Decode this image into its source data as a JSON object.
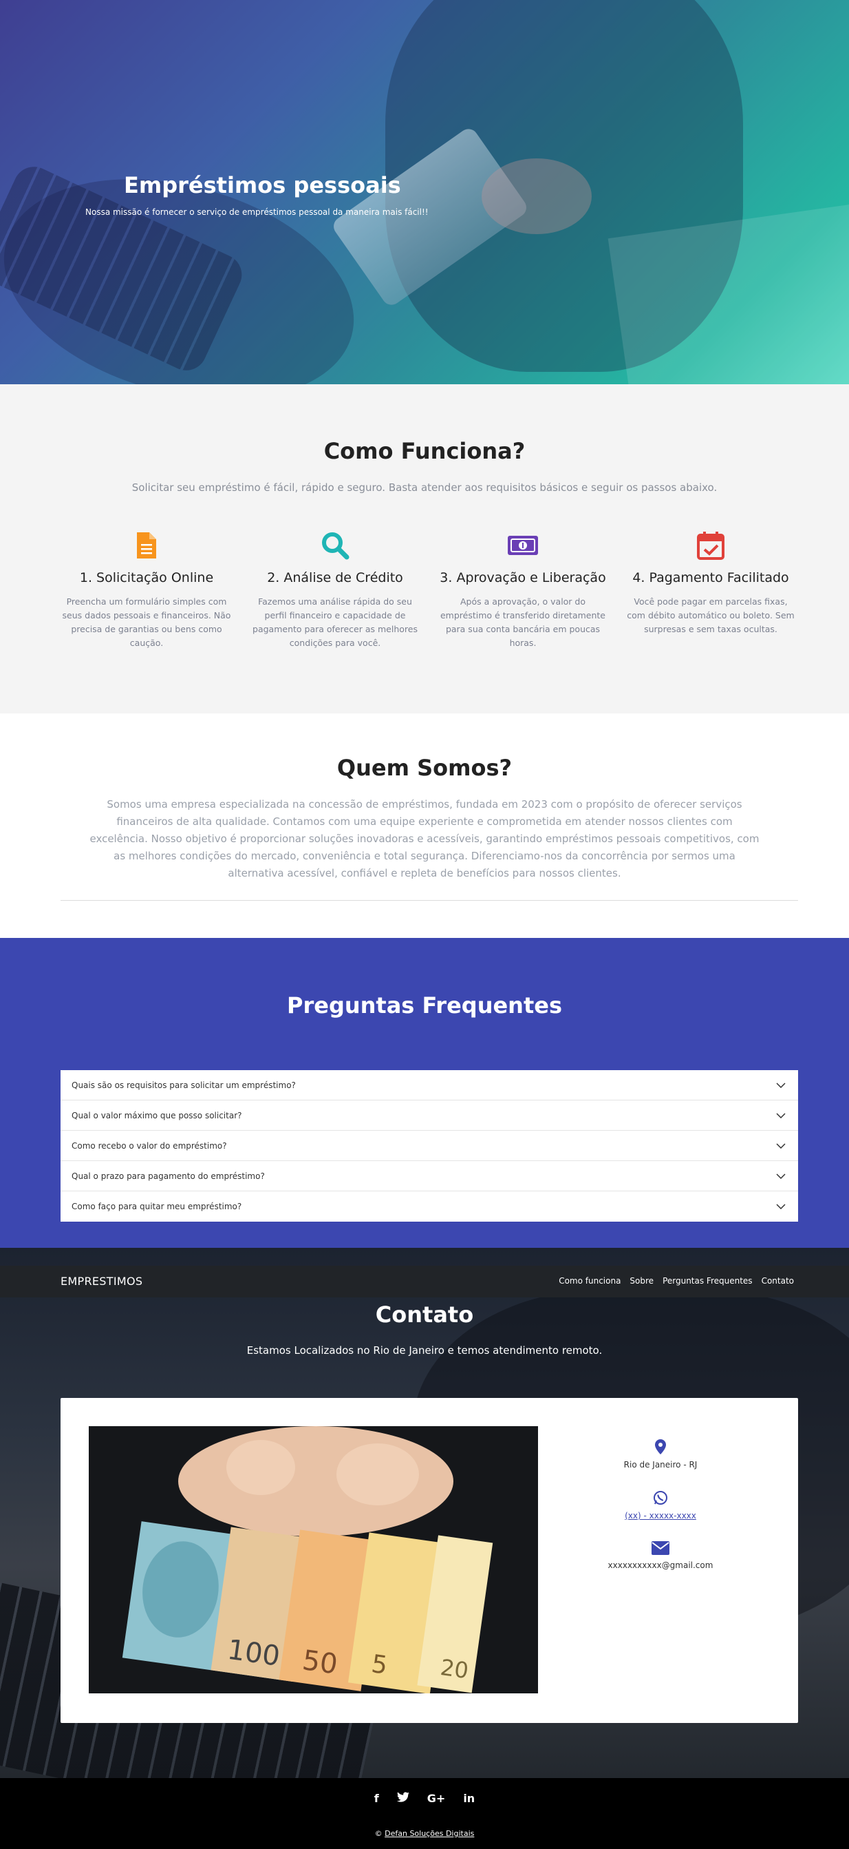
{
  "hero": {
    "title": "Empréstimos pessoais",
    "subtitle": "Nossa missão é fornecer o serviço de empréstimos pessoal da maneira mais fácil!!"
  },
  "como_funciona": {
    "title": "Como Funciona?",
    "subtitle": "Solicitar seu empréstimo é fácil, rápido e seguro. Basta atender aos requisitos básicos e seguir os passos abaixo.",
    "steps": [
      {
        "icon": "document-icon",
        "icon_color": "#f7941d",
        "title": "1. Solicitação Online",
        "text": "Preencha um formulário simples com seus dados pessoais e financeiros. Não precisa de garantias ou bens como caução."
      },
      {
        "icon": "search-icon",
        "icon_color": "#1fb5b5",
        "title": "2. Análise de Crédito",
        "text": "Fazemos uma análise rápida do seu perfil financeiro e capacidade de pagamento para oferecer as melhores condições para você."
      },
      {
        "icon": "money-bill-icon",
        "icon_color": "#6a3fb5",
        "title": "3. Aprovação e Liberação",
        "text": "Após a aprovação, o valor do empréstimo é transferido diretamente para sua conta bancária em poucas horas."
      },
      {
        "icon": "calendar-check-icon",
        "icon_color": "#e0413a",
        "title": "4. Pagamento Facilitado",
        "text": "Você pode pagar em parcelas fixas, com débito automático ou boleto. Sem surpresas e sem taxas ocultas."
      }
    ]
  },
  "quem_somos": {
    "title": "Quem Somos?",
    "text": "Somos uma empresa especializada na concessão de empréstimos, fundada em 2023 com o propósito de oferecer serviços financeiros de alta qualidade. Contamos com uma equipe experiente e comprometida em atender nossos clientes com excelência. Nosso objetivo é proporcionar soluções inovadoras e acessíveis, garantindo empréstimos pessoais competitivos, com as melhores condições do mercado, conveniência e total segurança. Diferenciamo-nos da concorrência por sermos uma alternativa acessível, confiável e repleta de benefícios para nossos clientes."
  },
  "faq": {
    "title": "Preguntas Frequentes",
    "items": [
      "Quais são os requisitos para solicitar um empréstimo?",
      "Qual o valor máximo que posso solicitar?",
      "Como recebo o valor do empréstimo?",
      "Qual o prazo para pagamento do empréstimo?",
      "Como faço para quitar meu empréstimo?"
    ]
  },
  "navbar": {
    "brand": "EMPRESTIMOS",
    "links": [
      "Como funciona",
      "Sobre",
      "Perguntas Frequentes",
      "Contato"
    ]
  },
  "contato": {
    "title": "Contato",
    "subtitle": "Estamos Localizados no Rio de Janeiro e temos atendimento remoto.",
    "location": "Rio de Janeiro - RJ",
    "phone": "(xx) - xxxxx-xxxx",
    "email": "xxxxxxxxxxx@gmail.com"
  },
  "footer": {
    "social": [
      "f",
      "🐦",
      "G+",
      "in"
    ],
    "copyright_symbol": "©",
    "copyright_link": "Defan Soluções Digitais"
  },
  "colors": {
    "primary": "#3c47b0",
    "text_muted": "#8a8f99"
  }
}
